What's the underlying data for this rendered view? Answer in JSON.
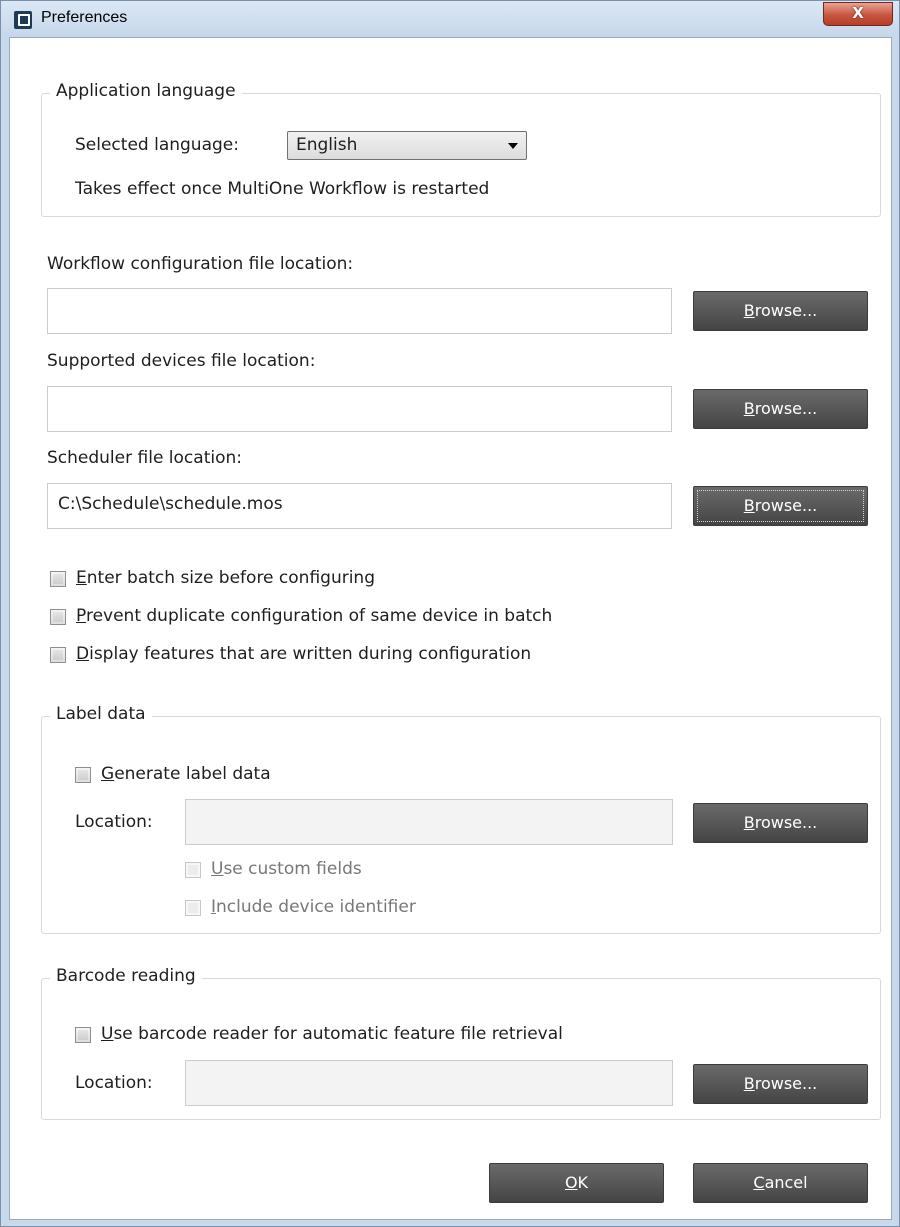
{
  "window": {
    "title": "Preferences",
    "close_glyph": "X"
  },
  "app_language": {
    "group_title": "Application language",
    "selected_label": "Selected language:",
    "selected_value": "English",
    "note": "Takes effect once MultiOne Workflow is restarted"
  },
  "files": [
    {
      "label": "Workflow configuration file location:",
      "value": "",
      "button": "Browse..."
    },
    {
      "label": "Supported devices file location:",
      "value": "",
      "button": "Browse..."
    },
    {
      "label": "Scheduler file location:",
      "value": "C:\\Schedule\\schedule.mos",
      "button": "Browse..."
    }
  ],
  "options": [
    {
      "label": "Enter batch size before configuring",
      "checked": false
    },
    {
      "label": "Prevent duplicate configuration of same device in batch",
      "checked": false
    },
    {
      "label": "Display features that are written during configuration",
      "checked": false
    }
  ],
  "label_data": {
    "group_title": "Label data",
    "generate_label": "Generate label data",
    "generate_checked": false,
    "location_label": "Location:",
    "location_value": "",
    "browse": "Browse...",
    "custom_fields": "Use custom fields",
    "include_identifier": "Include device identifier"
  },
  "barcode": {
    "group_title": "Barcode reading",
    "use_reader": "Use barcode reader for automatic feature file retrieval",
    "use_reader_checked": false,
    "location_label": "Location:",
    "location_value": "",
    "browse": "Browse..."
  },
  "footer": {
    "ok": "OK",
    "cancel": "Cancel"
  }
}
